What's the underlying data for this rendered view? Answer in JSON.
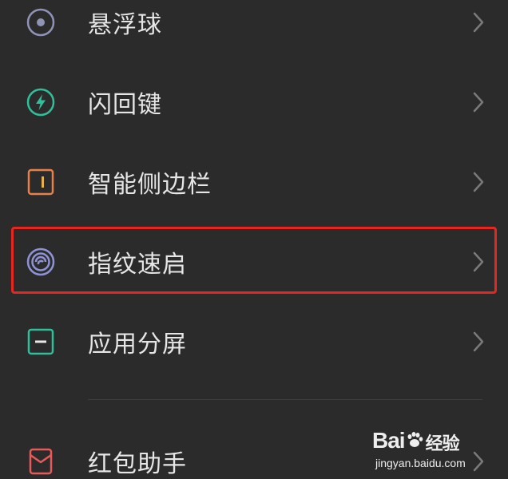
{
  "settings_list": {
    "items": [
      {
        "label": "悬浮球",
        "icon": "floating-ball-icon",
        "color": "#8f93b5"
      },
      {
        "label": "闪回键",
        "icon": "lightning-icon",
        "color": "#2fbf9a"
      },
      {
        "label": "智能侧边栏",
        "icon": "sidebar-icon",
        "color": "#e8804a"
      },
      {
        "label": "指纹速启",
        "icon": "fingerprint-icon",
        "color": "#8f93d6"
      },
      {
        "label": "应用分屏",
        "icon": "split-screen-icon",
        "color": "#2fbf9a"
      },
      {
        "label": "红包助手",
        "icon": "red-envelope-icon",
        "color": "#e85a5a"
      }
    ],
    "highlight_color": "#e5271f",
    "chevron": "chevron-right-icon"
  },
  "watermark": {
    "brand": "Bai",
    "brand_suffix": "经验",
    "url": "jingyan.baidu.com"
  }
}
